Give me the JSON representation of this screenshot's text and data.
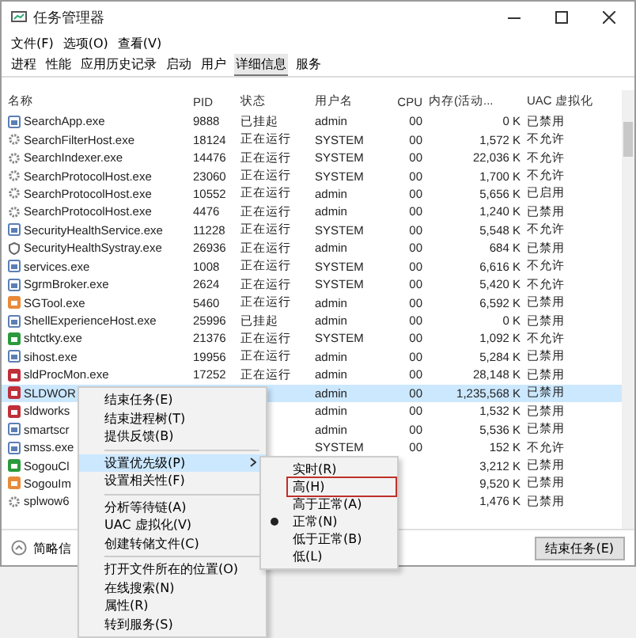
{
  "window": {
    "title": "任务管理器"
  },
  "menu": [
    "文件(F)",
    "选项(O)",
    "查看(V)"
  ],
  "tabs": [
    {
      "label": "进程",
      "selected": false
    },
    {
      "label": "性能",
      "selected": false
    },
    {
      "label": "应用历史记录",
      "selected": false
    },
    {
      "label": "启动",
      "selected": false
    },
    {
      "label": "用户",
      "selected": false
    },
    {
      "label": "详细信息",
      "selected": true
    },
    {
      "label": "服务",
      "selected": false
    }
  ],
  "table": {
    "columns": [
      "名称",
      "PID",
      "状态",
      "用户名",
      "CPU",
      "内存(活动...",
      "UAC 虚拟化"
    ],
    "rows": [
      {
        "name": "SearchApp.exe",
        "pid": "9888",
        "status": "已挂起",
        "user": "admin",
        "cpu": "00",
        "memory": "0 K",
        "uac": "已禁用",
        "selected": false
      },
      {
        "name": "SearchFilterHost.exe",
        "pid": "18124",
        "status": "正在运行",
        "user": "SYSTEM",
        "cpu": "00",
        "memory": "1,572 K",
        "uac": "不允许",
        "selected": false
      },
      {
        "name": "SearchIndexer.exe",
        "pid": "14476",
        "status": "正在运行",
        "user": "SYSTEM",
        "cpu": "00",
        "memory": "22,036 K",
        "uac": "不允许",
        "selected": false
      },
      {
        "name": "SearchProtocolHost.exe",
        "pid": "23060",
        "status": "正在运行",
        "user": "SYSTEM",
        "cpu": "00",
        "memory": "1,700 K",
        "uac": "不允许",
        "selected": false
      },
      {
        "name": "SearchProtocolHost.exe",
        "pid": "10552",
        "status": "正在运行",
        "user": "admin",
        "cpu": "00",
        "memory": "5,656 K",
        "uac": "已启用",
        "selected": false
      },
      {
        "name": "SearchProtocolHost.exe",
        "pid": "4476",
        "status": "正在运行",
        "user": "admin",
        "cpu": "00",
        "memory": "1,240 K",
        "uac": "已禁用",
        "selected": false
      },
      {
        "name": "SecurityHealthService.exe",
        "pid": "11228",
        "status": "正在运行",
        "user": "SYSTEM",
        "cpu": "00",
        "memory": "5,548 K",
        "uac": "不允许",
        "selected": false
      },
      {
        "name": "SecurityHealthSystray.exe",
        "pid": "26936",
        "status": "正在运行",
        "user": "admin",
        "cpu": "00",
        "memory": "684 K",
        "uac": "已禁用",
        "selected": false
      },
      {
        "name": "services.exe",
        "pid": "1008",
        "status": "正在运行",
        "user": "SYSTEM",
        "cpu": "00",
        "memory": "6,616 K",
        "uac": "不允许",
        "selected": false
      },
      {
        "name": "SgrmBroker.exe",
        "pid": "2624",
        "status": "正在运行",
        "user": "SYSTEM",
        "cpu": "00",
        "memory": "5,420 K",
        "uac": "不允许",
        "selected": false
      },
      {
        "name": "SGTool.exe",
        "pid": "5460",
        "status": "正在运行",
        "user": "admin",
        "cpu": "00",
        "memory": "6,592 K",
        "uac": "已禁用",
        "selected": false
      },
      {
        "name": "ShellExperienceHost.exe",
        "pid": "25996",
        "status": "已挂起",
        "user": "admin",
        "cpu": "00",
        "memory": "0 K",
        "uac": "已禁用",
        "selected": false
      },
      {
        "name": "shtctky.exe",
        "pid": "21376",
        "status": "正在运行",
        "user": "SYSTEM",
        "cpu": "00",
        "memory": "1,092 K",
        "uac": "不允许",
        "selected": false
      },
      {
        "name": "sihost.exe",
        "pid": "19956",
        "status": "正在运行",
        "user": "admin",
        "cpu": "00",
        "memory": "5,284 K",
        "uac": "已禁用",
        "selected": false
      },
      {
        "name": "sldProcMon.exe",
        "pid": "17252",
        "status": "正在运行",
        "user": "admin",
        "cpu": "00",
        "memory": "28,148 K",
        "uac": "已禁用",
        "selected": false
      },
      {
        "name": "SLDWOR",
        "user": "admin",
        "cpu": "00",
        "memory": "1,235,568 K",
        "uac": "已禁用",
        "selected": true
      },
      {
        "name": "sldworks",
        "user": "admin",
        "cpu": "00",
        "memory": "1,532 K",
        "uac": "已禁用",
        "selected": false
      },
      {
        "name": "smartscr",
        "user": "admin",
        "cpu": "00",
        "memory": "5,536 K",
        "uac": "已禁用",
        "selected": false
      },
      {
        "name": "smss.exe",
        "user": "SYSTEM",
        "cpu": "00",
        "memory": "152 K",
        "uac": "不允许",
        "selected": false
      },
      {
        "name": "SogouCl",
        "memory": "3,212 K",
        "uac": "已禁用",
        "selected": false
      },
      {
        "name": "SogouIm",
        "memory": "9,520 K",
        "uac": "已禁用",
        "selected": false
      },
      {
        "name": "splwow6",
        "memory": "1,476 K",
        "uac": "已禁用",
        "selected": false
      }
    ]
  },
  "footer": {
    "details_label": "简略信",
    "end_task": "结束任务(E)"
  },
  "context_menu": {
    "items": [
      {
        "label": "结束任务(E)",
        "kind": "item",
        "highlighted": false
      },
      {
        "label": "结束进程树(T)",
        "kind": "item",
        "highlighted": false
      },
      {
        "label": "提供反馈(B)",
        "kind": "item",
        "highlighted": false
      },
      {
        "kind": "separator"
      },
      {
        "label": "设置优先级(P)",
        "kind": "submenu",
        "highlighted": true
      },
      {
        "label": "设置相关性(F)",
        "kind": "item",
        "highlighted": false
      },
      {
        "kind": "separator"
      },
      {
        "label": "分析等待链(A)",
        "kind": "item",
        "highlighted": false
      },
      {
        "label": "UAC 虚拟化(V)",
        "kind": "item",
        "highlighted": false
      },
      {
        "label": "创建转储文件(C)",
        "kind": "item",
        "highlighted": false
      },
      {
        "kind": "separator"
      },
      {
        "label": "打开文件所在的位置(O)",
        "kind": "item",
        "highlighted": false
      },
      {
        "label": "在线搜索(N)",
        "kind": "item",
        "highlighted": false
      },
      {
        "label": "属性(R)",
        "kind": "item",
        "highlighted": false
      },
      {
        "label": "转到服务(S)",
        "kind": "item",
        "highlighted": false
      }
    ]
  },
  "priority_menu": {
    "items": [
      {
        "label": "实时(R)",
        "selected": false,
        "outlined": false
      },
      {
        "label": "高(H)",
        "selected": false,
        "outlined": true
      },
      {
        "label": "高于正常(A)",
        "selected": false,
        "outlined": false
      },
      {
        "label": "正常(N)",
        "selected": true,
        "outlined": false
      },
      {
        "label": "低于正常(B)",
        "selected": false,
        "outlined": false
      },
      {
        "label": "低(L)",
        "selected": false,
        "outlined": false
      }
    ]
  }
}
